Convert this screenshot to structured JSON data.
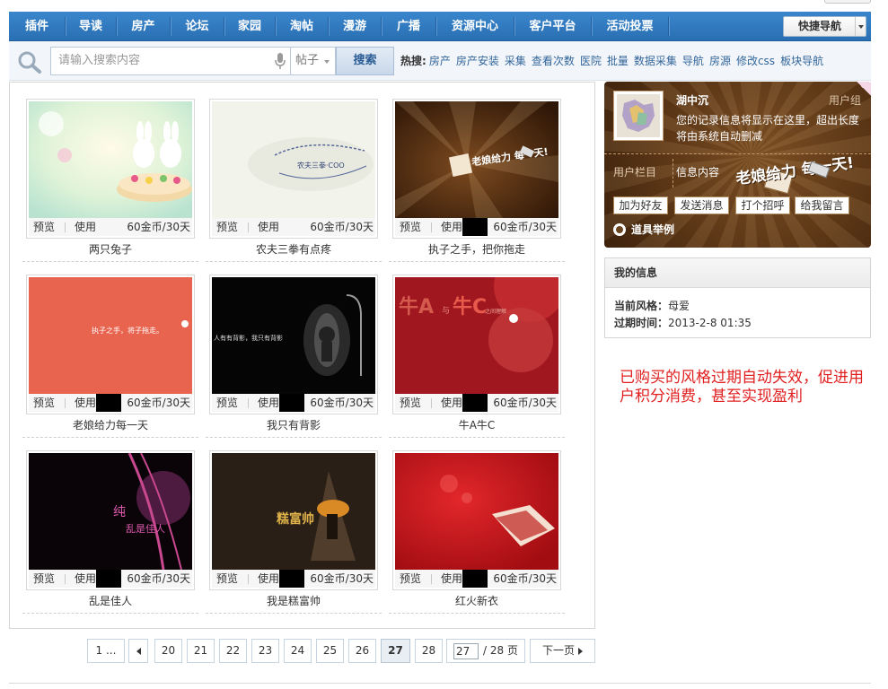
{
  "nav": {
    "items": [
      "插件",
      "导读",
      "房产",
      "论坛",
      "家园",
      "淘帖",
      "漫游",
      "广播",
      "资源中心",
      "客户平台",
      "活动投票"
    ],
    "quick_nav": "快捷导航"
  },
  "search": {
    "placeholder": "请输入搜索内容",
    "type": "帖子",
    "button": "搜索",
    "hot_label": "热搜:",
    "hot_links": [
      "房产",
      "房产安装",
      "采集",
      "查看次数",
      "医院",
      "批量",
      "数据采集",
      "导航",
      "房源",
      "修改css",
      "板块导航"
    ]
  },
  "cards": [
    {
      "title": "两只兔子",
      "preview": "预览",
      "use": "使用",
      "price": "60金币/30天"
    },
    {
      "title": "农夫三拳有点疼",
      "preview": "预览",
      "use": "使用",
      "price": "60金币/30天"
    },
    {
      "title": "执子之手，把你拖走",
      "preview": "预览",
      "use": "使用",
      "price": "60金币/30天"
    },
    {
      "title": "老娘给力每一天",
      "preview": "预览",
      "use": "使用",
      "price": "60金币/30天"
    },
    {
      "title": "我只有背影",
      "preview": "预览",
      "use": "使用",
      "price": "60金币/30天"
    },
    {
      "title": "牛A牛C",
      "preview": "预览",
      "use": "使用",
      "price": "60金币/30天"
    },
    {
      "title": "乱是佳人",
      "preview": "预览",
      "use": "使用",
      "price": "60金币/30天"
    },
    {
      "title": "我是糕富帅",
      "preview": "预览",
      "use": "使用",
      "price": "60金币/30天"
    },
    {
      "title": "红火新衣",
      "preview": "预览",
      "use": "使用",
      "price": "60金币/30天"
    }
  ],
  "thumb_text": {
    "nongfu": "农夫三拳·COO",
    "zhizi": "老娘给力 每一天!",
    "laoniang": "执子之手，将子拖走。",
    "beiying": "人有有背影，我只有背影",
    "niu": [
      "牛A",
      "与",
      "牛C",
      "之间理解"
    ],
    "luan": [
      "纯",
      "乱是佳人"
    ],
    "gao": "糕富帅"
  },
  "pagination": {
    "first": "1 ...",
    "pages": [
      "20",
      "21",
      "22",
      "23",
      "24",
      "25",
      "26",
      "27",
      "28"
    ],
    "current": "27",
    "input_value": "27",
    "total": "/ 28 页",
    "next": "下一页"
  },
  "profile": {
    "username": "湖中沉",
    "group": "用户组",
    "desc": "您的记录信息将显示在这里，超出长度将由系统自动删减",
    "col1": "用户栏目",
    "col2": "信息内容",
    "slogan": "老娘给力 每一天!",
    "buttons": [
      "加为好友",
      "发送消息",
      "打个招呼",
      "给我留言"
    ],
    "example": "道具举例"
  },
  "myinfo": {
    "title": "我的信息",
    "style_label": "当前风格：",
    "style_value": "母爱",
    "expire_label": "过期时间：",
    "expire_value": "2013-2-8 01:35"
  },
  "note": "已购买的风格过期自动失效，促进用户积分消费，甚至实现盈利",
  "colors": {
    "nav": "#2f7bc2",
    "note": "#e02020",
    "link": "#336699"
  }
}
